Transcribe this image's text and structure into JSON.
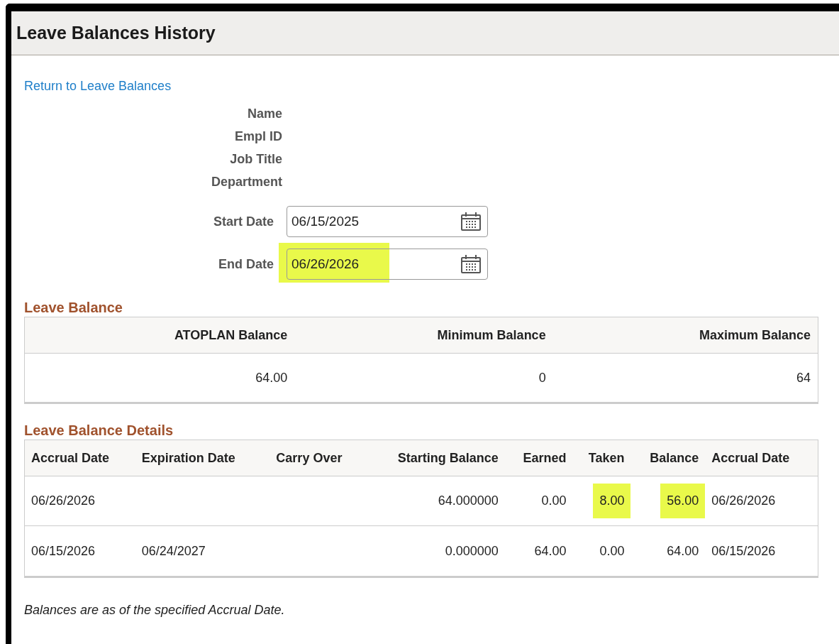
{
  "page": {
    "title": "Leave Balances History"
  },
  "return_link": "Return to Leave Balances",
  "employee_fields": [
    "Name",
    "Empl ID",
    "Job Title",
    "Department"
  ],
  "date_fields": [
    {
      "label": "Start Date",
      "value": "06/15/2025",
      "highlighted": false
    },
    {
      "label": "End Date",
      "value": "06/26/2026",
      "highlighted": true
    }
  ],
  "leave_balance": {
    "title": "Leave Balance",
    "columns": [
      "ATOPLAN Balance",
      "Minimum Balance",
      "Maximum Balance"
    ],
    "rows": [
      [
        "64.00",
        "0",
        "64"
      ]
    ]
  },
  "leave_balance_details": {
    "title": "Leave Balance Details",
    "columns": [
      "Accrual Date",
      "Expiration Date",
      "Carry Over",
      "Starting Balance",
      "Earned",
      "Taken",
      "Balance",
      "Accrual Date"
    ],
    "rows": [
      [
        {
          "text": "06/26/2026"
        },
        {},
        {},
        {
          "text": "64.000000"
        },
        {
          "text": "0.00"
        },
        {
          "text": "8.00",
          "highlighted": true
        },
        {
          "text": "56.00",
          "highlighted": true
        },
        {
          "text": "06/26/2026"
        }
      ],
      [
        {
          "text": "06/15/2026"
        },
        {
          "text": "06/24/2027"
        },
        {},
        {
          "text": "0.000000"
        },
        {
          "text": "64.00"
        },
        {
          "text": "0.00"
        },
        {
          "text": "64.00"
        },
        {
          "text": "06/15/2026"
        }
      ]
    ]
  },
  "footnote": "Balances are as of the specified Accrual Date."
}
